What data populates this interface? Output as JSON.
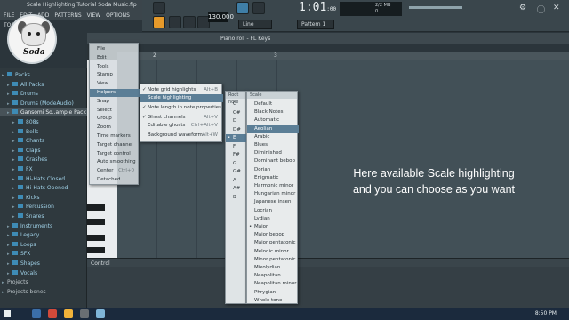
{
  "window": {
    "title": "Scale Highlighting Tutorial Soda Music.flp",
    "menu": [
      "FILE",
      "EDIT",
      "ADD",
      "PATTERNS",
      "VIEW",
      "OPTIONS",
      "TOOLS",
      "?"
    ]
  },
  "toolbar": {
    "tempo": "130.000",
    "time_main": "1:01",
    "time_sub": ":00",
    "pattern": "Pattern 1",
    "cpu_line1": "2/2 MB",
    "cpu_line2": "0",
    "snap": "Line"
  },
  "brand": {
    "name": "Soda"
  },
  "piano_roll": {
    "title": "Piano roll - FL Keys",
    "control_label": "Control",
    "ruler": [
      "2",
      "3"
    ]
  },
  "browser": {
    "items": [
      {
        "label": "Packs",
        "kind": "folder",
        "indent": 0
      },
      {
        "label": "All Packs",
        "kind": "folder",
        "indent": 1
      },
      {
        "label": "Drums",
        "kind": "folder",
        "indent": 1
      },
      {
        "label": "Drums (ModeAudio)",
        "kind": "folder",
        "indent": 1
      },
      {
        "label": "Gansomi So..ample Pack",
        "kind": "folder",
        "indent": 1,
        "highlight": true
      },
      {
        "label": "808s",
        "kind": "folder",
        "indent": 2
      },
      {
        "label": "Bells",
        "kind": "folder",
        "indent": 2
      },
      {
        "label": "Chants",
        "kind": "folder",
        "indent": 2
      },
      {
        "label": "Claps",
        "kind": "folder",
        "indent": 2
      },
      {
        "label": "Crashes",
        "kind": "folder",
        "indent": 2
      },
      {
        "label": "FX",
        "kind": "folder",
        "indent": 2
      },
      {
        "label": "Hi-Hats Closed",
        "kind": "folder",
        "indent": 2
      },
      {
        "label": "Hi-Hats Opened",
        "kind": "folder",
        "indent": 2
      },
      {
        "label": "Kicks",
        "kind": "folder",
        "indent": 2
      },
      {
        "label": "Percussion",
        "kind": "folder",
        "indent": 2
      },
      {
        "label": "Snares",
        "kind": "folder",
        "indent": 2
      },
      {
        "label": "Instruments",
        "kind": "folder",
        "indent": 1
      },
      {
        "label": "Legacy",
        "kind": "folder",
        "indent": 1
      },
      {
        "label": "Loops",
        "kind": "folder",
        "indent": 1
      },
      {
        "label": "SFX",
        "kind": "folder",
        "indent": 1
      },
      {
        "label": "Shapes",
        "kind": "folder",
        "indent": 1
      },
      {
        "label": "Vocals",
        "kind": "folder",
        "indent": 1
      },
      {
        "label": "Projects",
        "kind": "plain",
        "indent": 0
      },
      {
        "label": "Projects bones",
        "kind": "plain",
        "indent": 0
      }
    ]
  },
  "menu_main": {
    "items": [
      "File",
      "Edit",
      "Tools",
      "Stamp",
      "View",
      "Helpers",
      "Snap",
      "Select",
      "Group",
      "Zoom",
      "Time markers",
      "Target channel",
      "Target control",
      "Auto smoothing",
      "Center",
      "Detached"
    ],
    "shortcuts": {
      "Center": "Ctrl+0"
    },
    "selected": "Helpers"
  },
  "menu_helpers": {
    "items": [
      {
        "label": "Note grid highlights",
        "check": true,
        "shortcut": "Alt+B"
      },
      {
        "label": "Scale highlighting",
        "check": false,
        "shortcut": "",
        "selected": true
      },
      {
        "label": "Note length in note properties",
        "check": true,
        "shortcut": ""
      },
      {
        "label": "Ghost channels",
        "check": true,
        "shortcut": "Alt+V"
      },
      {
        "label": "Editable ghosts",
        "check": false,
        "shortcut": "Ctrl+Alt+V"
      },
      {
        "label": "Background waveform",
        "check": false,
        "shortcut": "Alt+W"
      }
    ]
  },
  "menu_root": {
    "header": "Root note",
    "items": [
      "C",
      "C#",
      "D",
      "D#",
      "E",
      "F",
      "F#",
      "G",
      "G#",
      "A",
      "A#",
      "B"
    ],
    "selected": "E"
  },
  "menu_scale": {
    "header": "Scale",
    "items": [
      "Default",
      "Black Notes",
      "Automatic",
      "Aeolian",
      "Arabic",
      "Blues",
      "Diminished",
      "Dominant bebop",
      "Dorian",
      "Enigmatic",
      "Harmonic minor",
      "Hungarian minor",
      "Japanese insen",
      "Locrian",
      "Lydian",
      "Major",
      "Major bebop",
      "Major pentatonic",
      "Melodic minor",
      "Minor pentatonic",
      "Mixolydian",
      "Neapolitan",
      "Neapolitan minor",
      "Phrygian",
      "Whole tone"
    ],
    "selected": "Aeolian",
    "bullet": "Major"
  },
  "caption": {
    "line1": "Here available Scale highlighting",
    "line2": "and you can choose as you want"
  },
  "taskbar": {
    "clock": "8:50 PM"
  }
}
